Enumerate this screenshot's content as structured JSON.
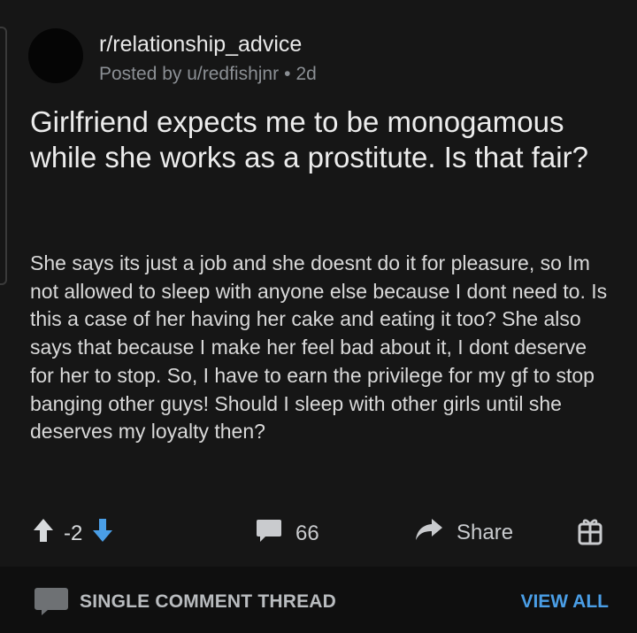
{
  "post": {
    "subreddit": "r/relationship_advice",
    "posted_by": "Posted by u/redfishjnr",
    "dot": "•",
    "age": "2d",
    "title": "Girlfriend expects me to be monogamous while she works as a prostitute. Is that fair?",
    "body": "She says its just a job and she doesnt do it for pleasure, so Im not allowed to sleep with anyone else because I dont need to. Is this a case of her having her cake and eating it too?  She also says that because I make her feel bad about it, I dont deserve for her to stop. So, I have to earn the privilege for my gf to stop banging other guys! Should I sleep with other girls until she deserves my loyalty then?"
  },
  "actions": {
    "score": "-2",
    "comment_count": "66",
    "share_label": "Share"
  },
  "footer": {
    "thread_label": "SINGLE COMMENT THREAD",
    "view_all_label": "VIEW ALL"
  },
  "colors": {
    "background": "#161616",
    "upvote": "#d7dadc",
    "downvote": "#4a9ee6",
    "link": "#4a9ee6"
  },
  "icons": [
    "upvote-arrow-icon",
    "downvote-arrow-icon",
    "comment-bubble-icon",
    "share-arrow-icon",
    "award-gift-icon",
    "thread-bubble-icon"
  ]
}
